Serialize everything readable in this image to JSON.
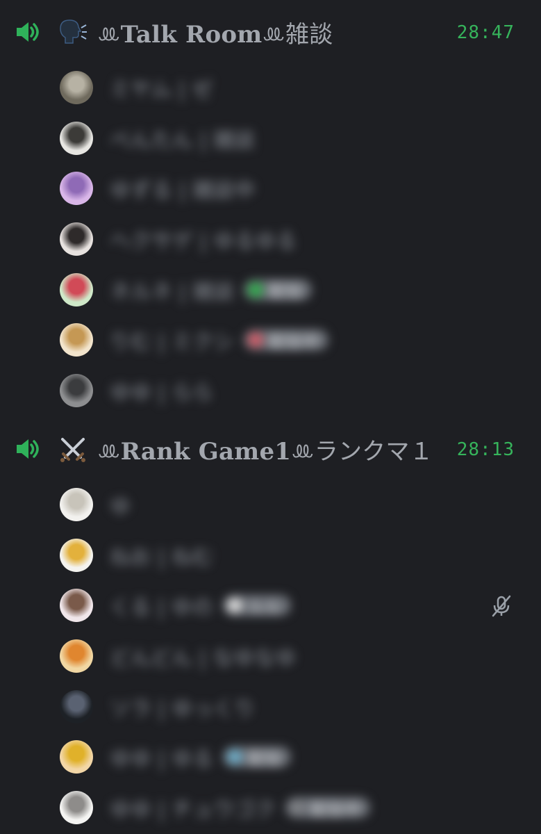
{
  "channels": [
    {
      "icon": "speaker-icon",
      "emoji": "speaking-head-icon",
      "title": "Talk Room",
      "separator": "ꔛ",
      "subtitle": "雑談",
      "timer": "28:47",
      "members": [
        {
          "avatar_colors": [
            "#6f6a5d",
            "#b7b2a4"
          ],
          "name": "ミヤム | ゼ",
          "badge": null
        },
        {
          "avatar_colors": [
            "#e7e6e2",
            "#3c3b38"
          ],
          "name": "べんたん | 雑談",
          "badge": null
        },
        {
          "avatar_colors": [
            "#d9b6e8",
            "#8f6ab6"
          ],
          "name": "ゆずる | 雑談中",
          "badge": null
        },
        {
          "avatar_colors": [
            "#e7e2df",
            "#2e2a2a"
          ],
          "name": "ヘクサゲ | ゆるゆる",
          "badge": null
        },
        {
          "avatar_colors": [
            "#cfe8c8",
            "#d14a57"
          ],
          "name": "ネルネ | 雑談",
          "badge": {
            "color": "#2fa84b",
            "label": "配信"
          }
        },
        {
          "avatar_colors": [
            "#f2e4cc",
            "#c59854"
          ],
          "name": "りむ | ミクシ",
          "badge": {
            "color": "#cd5a66",
            "label": "配信中"
          }
        },
        {
          "avatar_colors": [
            "#8d8e90",
            "#3b3c3e"
          ],
          "name": "ゆゆ | らら",
          "badge": null
        }
      ]
    },
    {
      "icon": "speaker-icon",
      "emoji": "crossed-swords-icon",
      "title": "Rank Game1",
      "separator": "ꔛ",
      "subtitle": "ランクマ１",
      "timer": "28:13",
      "members": [
        {
          "avatar_colors": [
            "#f2f1ee",
            "#c8c4ba"
          ],
          "name": "ゆ",
          "badge": null
        },
        {
          "avatar_colors": [
            "#f4f3ef",
            "#e3b13c"
          ],
          "name": "ねお | ねむ",
          "badge": null
        },
        {
          "avatar_colors": [
            "#f0e6ea",
            "#7a5a4a"
          ],
          "name": "くる | ゆの",
          "badge": {
            "color": "#d8d8d8",
            "label": "ルル"
          },
          "muted": true
        },
        {
          "avatar_colors": [
            "#f1d7a3",
            "#e0862f"
          ],
          "name": "どんどん | なゆなゆ",
          "badge": null
        },
        {
          "avatar_colors": [
            "#1d2126",
            "#5a6272"
          ],
          "name": "ソラ | ゆっくり",
          "badge": null
        },
        {
          "avatar_colors": [
            "#f2d6a6",
            "#e0b12a"
          ],
          "name": "ゆゆ | ゆる",
          "badge": {
            "color": "#6aa9c4",
            "label": "配信"
          }
        },
        {
          "avatar_colors": [
            "#f4f4f2",
            "#8e8c8a"
          ],
          "name": "ゆゆ | チュウゴク",
          "badge": {
            "color": "#7d7f83",
            "label": "配信中"
          }
        }
      ]
    }
  ]
}
